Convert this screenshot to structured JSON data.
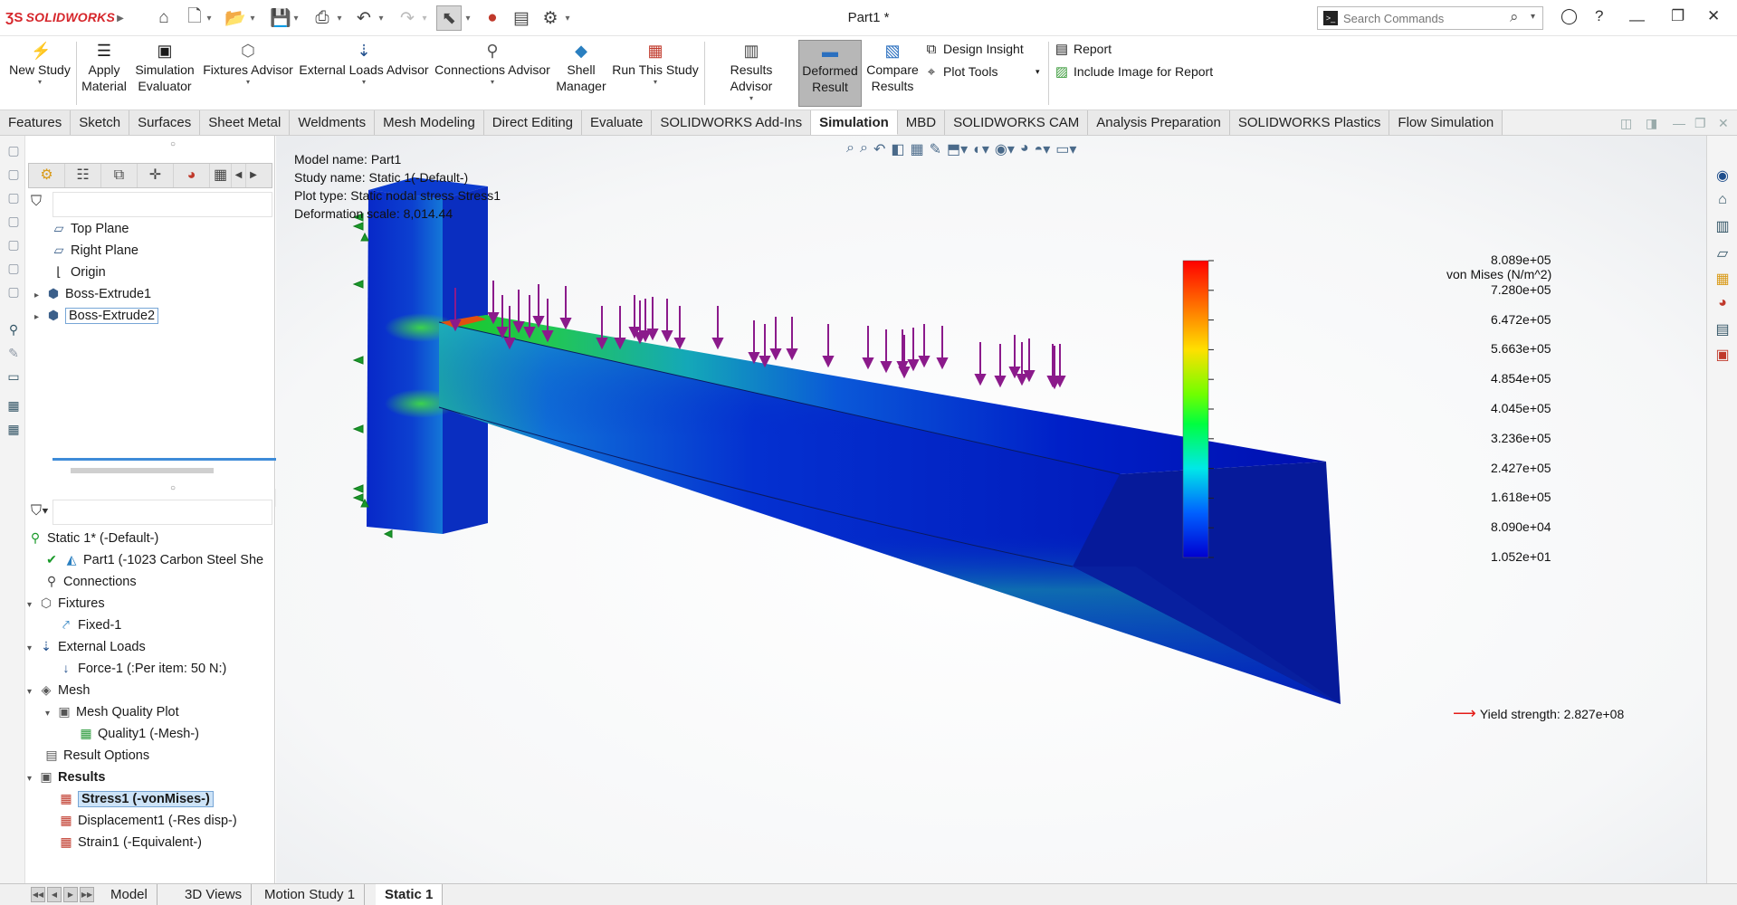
{
  "app": {
    "brand": "SOLIDWORKS",
    "document_title": "Part1 *"
  },
  "search": {
    "placeholder": "Search Commands"
  },
  "ribbon": {
    "new_study": "New Study",
    "apply_material": [
      "Apply",
      "Material"
    ],
    "simulation_evaluator": [
      "Simulation",
      "Evaluator"
    ],
    "fixtures_advisor": "Fixtures Advisor",
    "external_loads_advisor": "External Loads Advisor",
    "connections_advisor": "Connections Advisor",
    "shell_manager": [
      "Shell",
      "Manager"
    ],
    "run_this_study": "Run This Study",
    "results_advisor": "Results Advisor",
    "deformed_result": [
      "Deformed",
      "Result"
    ],
    "compare_results": [
      "Compare",
      "Results"
    ],
    "design_insight": "Design Insight",
    "plot_tools": "Plot Tools",
    "report": "Report",
    "include_image": "Include Image for Report"
  },
  "tabs": [
    "Features",
    "Sketch",
    "Surfaces",
    "Sheet Metal",
    "Weldments",
    "Mesh Modeling",
    "Direct Editing",
    "Evaluate",
    "SOLIDWORKS Add-Ins",
    "Simulation",
    "MBD",
    "SOLIDWORKS CAM",
    "Analysis Preparation",
    "SOLIDWORKS Plastics",
    "Flow Simulation"
  ],
  "active_tab": "Simulation",
  "feature_tree": {
    "top_plane": "Top Plane",
    "right_plane": "Right Plane",
    "origin": "Origin",
    "boss1": "Boss-Extrude1",
    "boss2": "Boss-Extrude2"
  },
  "study_tree": {
    "study": "Static 1* (-Default-)",
    "part": "Part1 (-1023 Carbon Steel She",
    "connections": "Connections",
    "fixtures": "Fixtures",
    "fixed": "Fixed-1",
    "external_loads": "External Loads",
    "force": "Force-1 (:Per item: 50 N:)",
    "mesh": "Mesh",
    "mesh_quality_plot": "Mesh Quality Plot",
    "quality1": "Quality1 (-Mesh-)",
    "result_options": "Result Options",
    "results": "Results",
    "stress1": "Stress1 (-vonMises-)",
    "displacement1": "Displacement1 (-Res disp-)",
    "strain1": "Strain1 (-Equivalent-)"
  },
  "plot_info": {
    "model_name": "Model name: Part1",
    "study_name": "Study name: Static 1(-Default-)",
    "plot_type": "Plot type: Static nodal stress Stress1",
    "deformation_scale": "Deformation scale: 8,014.44"
  },
  "legend": {
    "title": "von Mises (N/m^2)",
    "ticks": [
      "8.089e+05",
      "7.280e+05",
      "6.472e+05",
      "5.663e+05",
      "4.854e+05",
      "4.045e+05",
      "3.236e+05",
      "2.427e+05",
      "1.618e+05",
      "8.090e+04",
      "1.052e+01"
    ],
    "yield_strength": "Yield strength: 2.827e+08"
  },
  "bottom_tabs": [
    "Model",
    "3D Views",
    "Motion Study 1",
    "Static 1"
  ],
  "active_bottom_tab": "Static 1",
  "colors": {
    "brand_red": "#d6262b",
    "load_arrow": "#8b1a8b",
    "fixture": "#1a9a2a",
    "highlight": "#cde3f7"
  }
}
